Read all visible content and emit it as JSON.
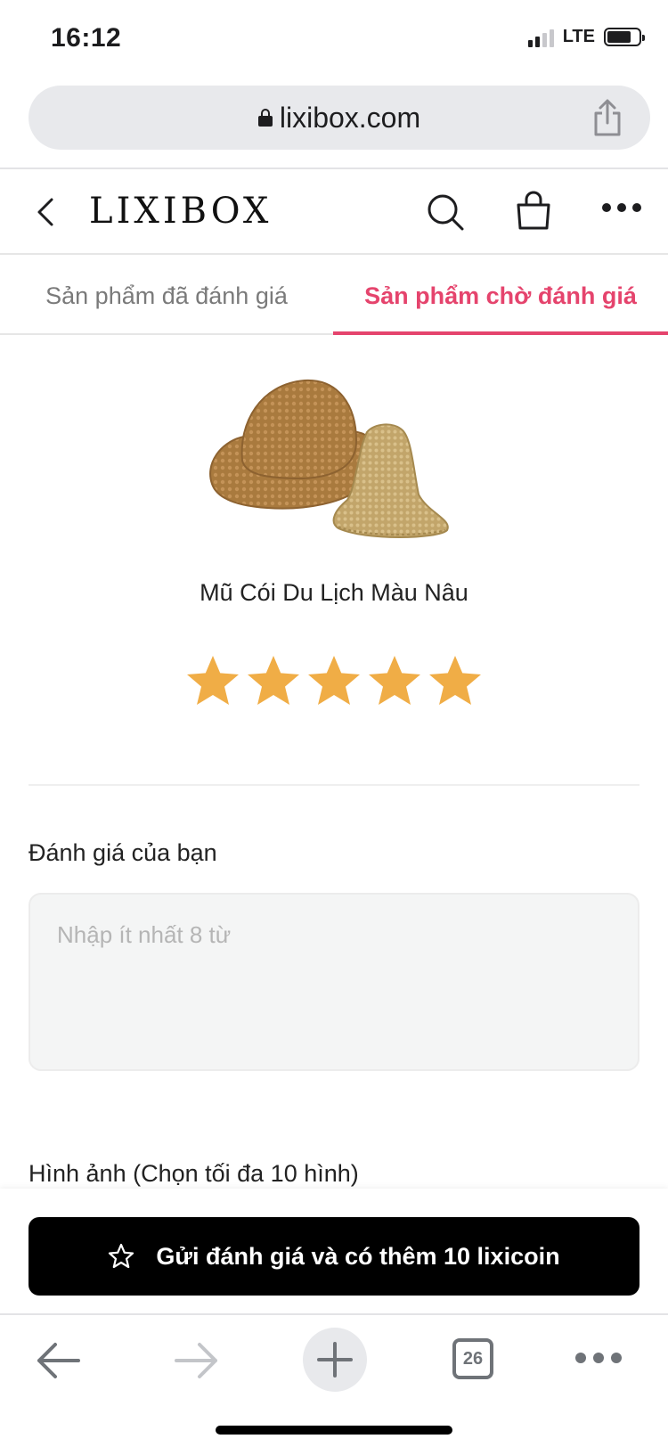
{
  "status_bar": {
    "time": "16:12",
    "network": "LTE"
  },
  "browser": {
    "url": "lixibox.com",
    "tab_count": "26"
  },
  "header": {
    "logo": "LIXIBOX"
  },
  "tabs": [
    {
      "label": "Sản phẩm đã đánh giá",
      "active": false
    },
    {
      "label": "Sản phẩm chờ đánh giá",
      "active": true
    }
  ],
  "product": {
    "name": "Mũ Cói Du Lịch Màu Nâu",
    "rating": 5,
    "rating_max": 5
  },
  "review": {
    "label": "Đánh giá của bạn",
    "placeholder": "Nhập ít nhất 8 từ",
    "value": ""
  },
  "images": {
    "label": "Hình ảnh (Chọn tối đa 10 hình)"
  },
  "submit": {
    "label": "Gửi đánh giá và có thêm 10 lixicoin"
  },
  "colors": {
    "accent": "#e5446d",
    "star": "#f0ad46",
    "button_bg": "#000000",
    "url_bar": "#e8e9ec"
  }
}
